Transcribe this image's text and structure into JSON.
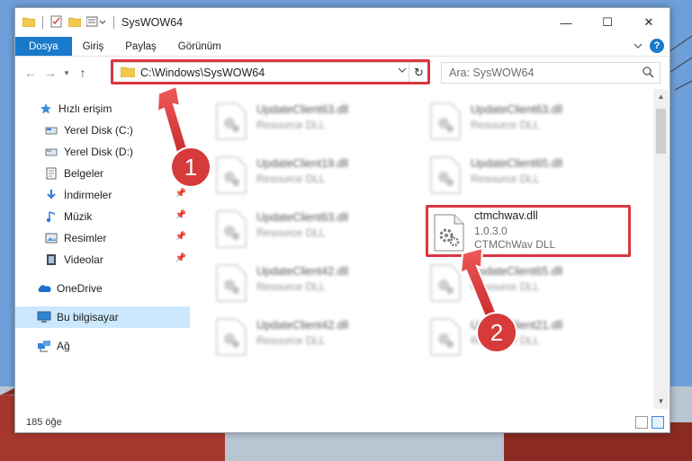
{
  "window": {
    "title": "SysWOW64",
    "controls": {
      "minimize": "—",
      "maximize": "☐",
      "close": "✕"
    }
  },
  "ribbon": {
    "tabs": [
      {
        "label": "Dosya",
        "active": true
      },
      {
        "label": "Giriş"
      },
      {
        "label": "Paylaş"
      },
      {
        "label": "Görünüm"
      }
    ],
    "help": "?"
  },
  "nav": {
    "address": "C:\\Windows\\SysWOW64",
    "search_placeholder": "Ara: SysWOW64"
  },
  "sidebar": {
    "items": [
      {
        "label": "Hızlı erişim",
        "icon": "star-icon"
      },
      {
        "label": "Yerel Disk (C:)",
        "icon": "drive-icon"
      },
      {
        "label": "Yerel Disk (D:)",
        "icon": "drive-icon"
      },
      {
        "label": "Belgeler",
        "icon": "documents-icon"
      },
      {
        "label": "İndirmeler",
        "icon": "downloads-icon",
        "pinned": true
      },
      {
        "label": "Müzik",
        "icon": "music-icon",
        "pinned": true
      },
      {
        "label": "Resimler",
        "icon": "pictures-icon",
        "pinned": true
      },
      {
        "label": "Videolar",
        "icon": "videos-icon",
        "pinned": true
      },
      {
        "label": "OneDrive",
        "icon": "cloud-icon"
      },
      {
        "label": "Bu bilgisayar",
        "icon": "computer-icon",
        "selected": true
      },
      {
        "label": "Ağ",
        "icon": "network-icon"
      }
    ]
  },
  "files": [
    {
      "name": "UpdateClient63.dll",
      "desc": "Resource DLL"
    },
    {
      "name": "UpdateClient63.dll",
      "desc": "Resource DLL"
    },
    {
      "name": "UpdateClient19.dll",
      "desc": "Resource DLL"
    },
    {
      "name": "UpdateClient65.dll",
      "desc": "Resource DLL"
    },
    {
      "name": "UpdateClient63.dll",
      "desc": "Resource DLL"
    },
    {
      "name": "ctmchwav.dll",
      "version": "1.0.3.0",
      "desc": "CTMChWav DLL",
      "highlighted": true
    },
    {
      "name": "UpdateClient42.dll",
      "desc": "Resource DLL"
    },
    {
      "name": "UpdateClient65.dll",
      "desc": "Resource DLL"
    },
    {
      "name": "UpdateClient42.dll",
      "desc": "Resource DLL"
    },
    {
      "name": "UpdateClient21.dll",
      "desc": "Resource DLL"
    }
  ],
  "status": {
    "count": "185 öğe"
  },
  "annotations": {
    "step1": "1",
    "step2": "2"
  },
  "colors": {
    "accent": "#1979ca",
    "highlight": "#d9363e",
    "selected": "#cce8ff"
  }
}
